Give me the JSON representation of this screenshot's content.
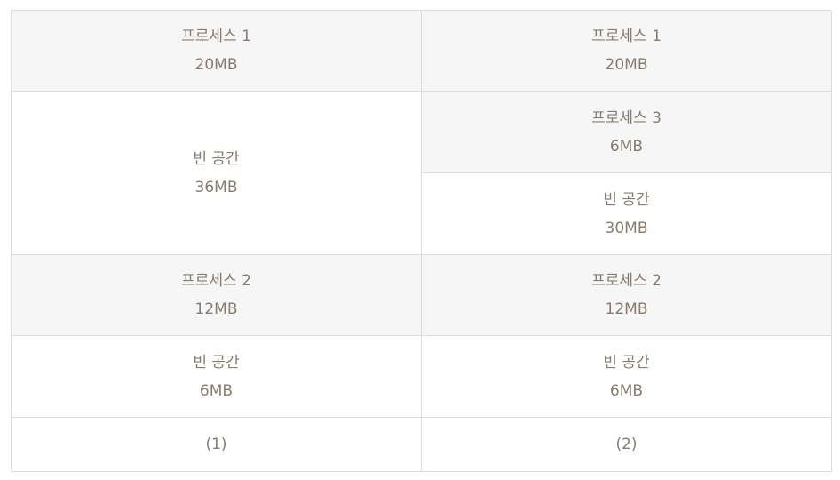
{
  "columns": [
    {
      "blocks": [
        {
          "name": "프로세스 1",
          "size": "20MB",
          "kind": "process"
        },
        {
          "name": "빈 공간",
          "size": "36MB",
          "kind": "free"
        },
        {
          "name": "프로세스 2",
          "size": "12MB",
          "kind": "process"
        },
        {
          "name": "빈 공간",
          "size": "6MB",
          "kind": "free"
        }
      ],
      "caption": "(1)"
    },
    {
      "blocks": [
        {
          "name": "프로세스 1",
          "size": "20MB",
          "kind": "process"
        },
        {
          "name": "프로세스 3",
          "size": "6MB",
          "kind": "process"
        },
        {
          "name": "빈 공간",
          "size": "30MB",
          "kind": "free"
        },
        {
          "name": "프로세스 2",
          "size": "12MB",
          "kind": "process"
        },
        {
          "name": "빈 공간",
          "size": "6MB",
          "kind": "free"
        }
      ],
      "caption": "(2)"
    }
  ],
  "colors": {
    "process_bg": "#f6f6f6",
    "free_bg": "#ffffff",
    "border": "#dcdcdc",
    "text": "#8a7b6c"
  }
}
